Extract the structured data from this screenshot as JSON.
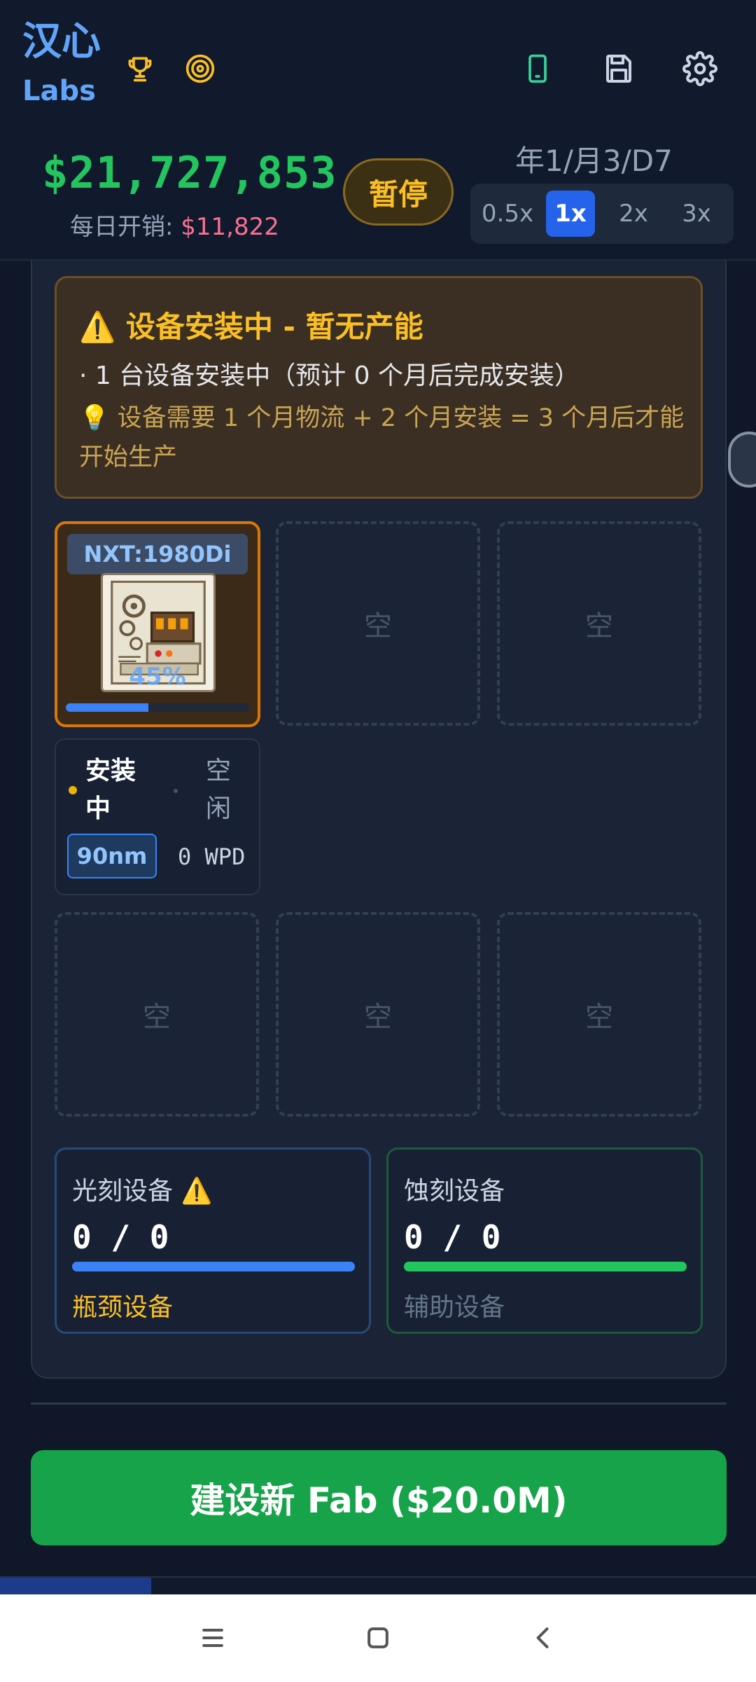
{
  "header": {
    "logo_main": "汉心",
    "logo_sub": "Labs",
    "icons": [
      "trophy-icon",
      "target-icon",
      "phone-icon",
      "save-icon",
      "gear-icon"
    ],
    "money": "$21,727,853",
    "daily_label": "每日开销:",
    "daily_value": "$11,822",
    "pause_label": "暂停",
    "date": "年1/月3/D7",
    "speeds": [
      "0.5x",
      "1x",
      "2x",
      "3x"
    ],
    "active_speed": "1x"
  },
  "alert": {
    "title": "⚠️ 设备安装中 - 暂无产能",
    "line": "· 1 台设备安装中（预计 0 个月后完成安装）",
    "tip": "💡 设备需要 1 个月物流 + 2 个月安装 = 3 个月后才能开始生产"
  },
  "equipment": {
    "name": "NXT:1980Di",
    "progress_label": "45%",
    "progress": 0.45,
    "empty_label": "空"
  },
  "status": {
    "installing": "安装中",
    "idle": "空闲",
    "node": "90nm",
    "wpd": "0 WPD"
  },
  "counters": {
    "litho_title": "光刻设备 ⚠️",
    "litho_value": "0 / 0",
    "litho_sub": "瓶颈设备",
    "etch_title": "蚀刻设备",
    "etch_value": "0 / 0",
    "etch_sub": "辅助设备"
  },
  "build_button": "建设新 Fab ($20.0M)",
  "colors": {
    "accent_blue": "#2563eb",
    "money_green": "#22c55e",
    "warn_amber": "#fbbf24",
    "build_green": "#16a34a"
  }
}
